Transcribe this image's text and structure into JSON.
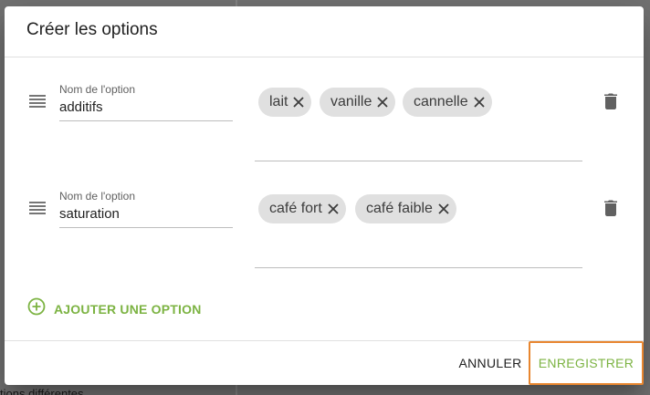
{
  "background": {
    "partial_text": "tions différentes"
  },
  "dialog": {
    "title": "Créer les options",
    "options": [
      {
        "field_label": "Nom de l'option",
        "value": "additifs",
        "chips": [
          "lait",
          "vanille",
          "cannelle"
        ]
      },
      {
        "field_label": "Nom de l'option",
        "value": "saturation",
        "chips": [
          "café fort",
          "café faible"
        ]
      }
    ],
    "add_option_label": "AJOUTER UNE OPTION",
    "actions": {
      "cancel_label": "ANNULER",
      "save_label": "ENREGISTRER"
    }
  },
  "colors": {
    "accent": "#7cb342",
    "focus_outline": "#e8862f",
    "chip_bg": "#e0e0e0",
    "icon": "#616161"
  },
  "icons": {
    "drag": "drag-handle-icon",
    "chip_remove": "close-icon",
    "delete": "trash-icon",
    "add": "add-circle-icon"
  }
}
